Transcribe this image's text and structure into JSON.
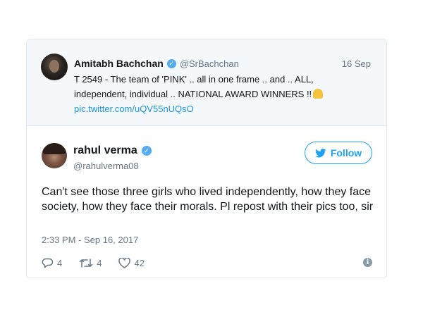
{
  "quoted_tweet": {
    "author_name": "Amitabh Bachchan",
    "author_handle": "@SrBachchan",
    "date": "16 Sep",
    "text_line1": "T 2549 - The team of 'PINK' .. all in one frame .. and .. ALL,",
    "text_line2": "independent, individual .. NATIONAL AWARD WINNERS !!",
    "link": "pic.twitter.com/uQV55nUQsO"
  },
  "tweet": {
    "author_name": "rahul verma",
    "author_handle": "@rahulverma08",
    "follow_label": "Follow",
    "text": "Can't see those three girls who lived independently, how they face society, how they face their morals. Pl repost with their pics too, sir",
    "timestamp": "2:33 PM - Sep 16, 2017",
    "replies": "4",
    "retweets": "4",
    "likes": "42"
  },
  "colors": {
    "link": "#1b95e0",
    "follow": "#1da1f2",
    "verified": "#55acee",
    "muted": "#657786"
  },
  "icons": [
    "verified-badge-icon",
    "twitter-bird-icon",
    "reply-icon",
    "retweet-icon",
    "like-icon",
    "info-icon",
    "folded-hands-emoji-icon"
  ]
}
